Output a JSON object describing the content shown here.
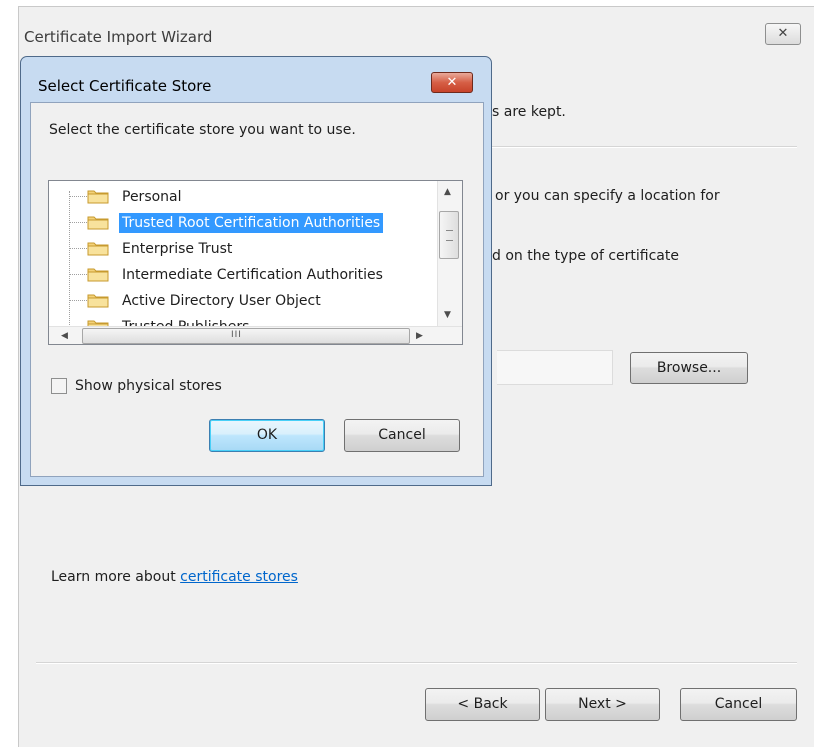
{
  "wizard": {
    "title": "Certificate Import Wizard",
    "close_glyph": "✕",
    "fragments": {
      "stores_kept": "s are kept.",
      "specify_location": "or you can specify a location for",
      "type_of_certificate": "d on the type of certificate"
    },
    "browse_label": "Browse...",
    "learn_prefix": "Learn more about ",
    "learn_link": "certificate stores",
    "back_label": "< Back",
    "next_label": "Next >",
    "cancel_label": "Cancel"
  },
  "dialog": {
    "title": "Select Certificate Store",
    "close_glyph": "✕",
    "prompt": "Select the certificate store you want to use.",
    "stores": [
      "Personal",
      "Trusted Root Certification Authorities",
      "Enterprise Trust",
      "Intermediate Certification Authorities",
      "Active Directory User Object",
      "Trusted Publishers"
    ],
    "selected_store": "Trusted Root Certification Authorities",
    "scroll_grip": "III",
    "show_physical_label": "Show physical stores",
    "show_physical_checked": false,
    "ok_label": "OK",
    "cancel_label": "Cancel"
  },
  "colors": {
    "selection": "#3399ff",
    "link": "#0066cc",
    "dialog_frame": "#c7dbf1",
    "close_button_red": "#c7432a"
  }
}
